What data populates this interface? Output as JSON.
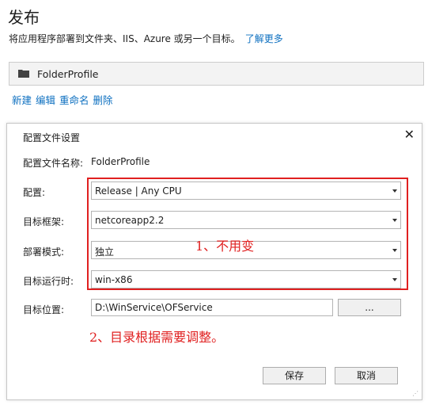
{
  "page": {
    "title": "发布",
    "subtitle": "将应用程序部署到文件夹、IIS、Azure 或另一个目标。",
    "learn_more": "了解更多"
  },
  "profile_bar": {
    "name": "FolderProfile",
    "icon": "folder-icon"
  },
  "actions": [
    "新建",
    "编辑",
    "重命名",
    "删除"
  ],
  "dialog": {
    "title": "配置文件设置",
    "close_label": "✕",
    "profile_name_label": "配置文件名称:",
    "profile_name_value": "FolderProfile",
    "config_label": "配置:",
    "config_value": "Release | Any CPU",
    "framework_label": "目标框架:",
    "framework_value": "netcoreapp2.2",
    "deploy_mode_label": "部署模式:",
    "deploy_mode_value": "独立",
    "runtime_label": "目标运行时:",
    "runtime_value": "win-x86",
    "target_location_label": "目标位置:",
    "target_location_value": "D:\\WinService\\OFService",
    "browse_label": "...",
    "save_label": "保存",
    "cancel_label": "取消"
  },
  "annotations": {
    "note1": "1、不用变",
    "note2": "2、目录根据需要调整。",
    "color": "#e02020"
  },
  "colors": {
    "link": "#0e70c0",
    "accent_red": "#e02020"
  }
}
